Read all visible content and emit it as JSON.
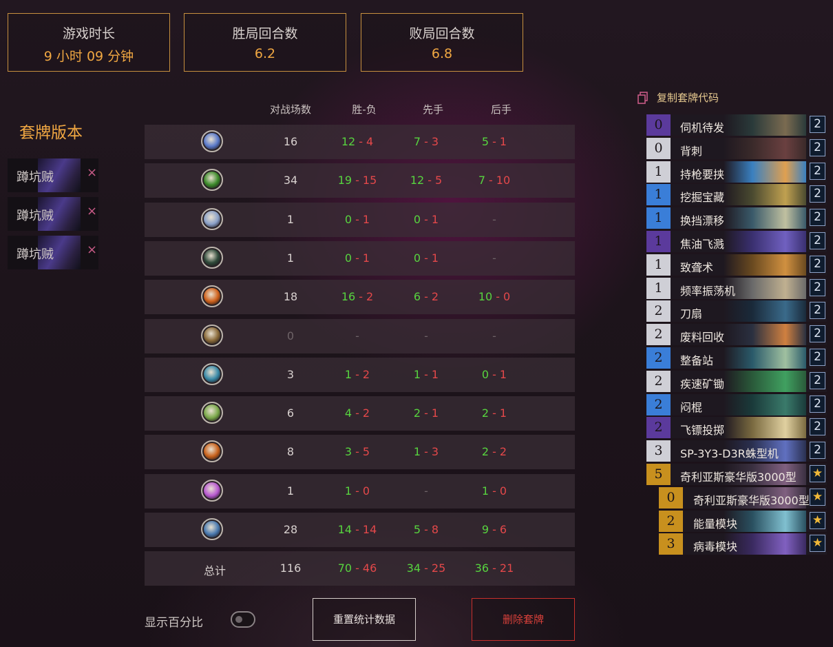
{
  "stats": {
    "playtime": {
      "label": "游戏时长",
      "value": "9 小时 09 分钟"
    },
    "win_turns": {
      "label": "胜局回合数",
      "value": "6.2"
    },
    "loss_turns": {
      "label": "败局回合数",
      "value": "6.8"
    }
  },
  "versions": {
    "title": "套牌版本",
    "items": [
      "蹲坑贼",
      "蹲坑贼",
      "蹲坑贼"
    ],
    "remove_symbol": "×"
  },
  "table": {
    "headers": {
      "games": "对战场数",
      "wl": "胜-负",
      "first": "先手",
      "second": "后手"
    },
    "dash": "-",
    "rows": [
      {
        "icon": "mage-class-icon",
        "color": "#5a79c9",
        "games": "16",
        "wl": [
          "12",
          "4"
        ],
        "first": [
          "7",
          "3"
        ],
        "second": [
          "5",
          "1"
        ]
      },
      {
        "icon": "warlock-class-icon",
        "color": "#3c8a2a",
        "games": "34",
        "wl": [
          "19",
          "15"
        ],
        "first": [
          "12",
          "5"
        ],
        "second": [
          "7",
          "10"
        ]
      },
      {
        "icon": "druid-class-icon",
        "color": "#8aa0c8",
        "games": "1",
        "wl": [
          "0",
          "1"
        ],
        "first": [
          "0",
          "1"
        ],
        "second": null
      },
      {
        "icon": "hunter-class-icon",
        "color": "#2f4a3a",
        "games": "1",
        "wl": [
          "0",
          "1"
        ],
        "first": [
          "0",
          "1"
        ],
        "second": null
      },
      {
        "icon": "shaman-class-icon",
        "color": "#d0621c",
        "games": "18",
        "wl": [
          "16",
          "2"
        ],
        "first": [
          "6",
          "2"
        ],
        "second": [
          "10",
          "0"
        ]
      },
      {
        "icon": "paladin-class-icon",
        "color": "#8a6a3a",
        "games": "0",
        "wl": null,
        "first": null,
        "second": null,
        "dim": true
      },
      {
        "icon": "rogue-class-icon",
        "color": "#3a8aa8",
        "games": "3",
        "wl": [
          "1",
          "2"
        ],
        "first": [
          "1",
          "1"
        ],
        "second": [
          "0",
          "1"
        ]
      },
      {
        "icon": "demon-hunter-class-icon",
        "color": "#7aa84a",
        "games": "6",
        "wl": [
          "4",
          "2"
        ],
        "first": [
          "2",
          "1"
        ],
        "second": [
          "2",
          "1"
        ]
      },
      {
        "icon": "warrior-class-icon",
        "color": "#c8621c",
        "games": "8",
        "wl": [
          "3",
          "5"
        ],
        "first": [
          "1",
          "3"
        ],
        "second": [
          "2",
          "2"
        ]
      },
      {
        "icon": "priest-class-icon",
        "color": "#b85ad0",
        "games": "1",
        "wl": [
          "1",
          "0"
        ],
        "first": null,
        "second": [
          "1",
          "0"
        ]
      },
      {
        "icon": "knight-class-icon",
        "color": "#4a7ab0",
        "games": "28",
        "wl": [
          "14",
          "14"
        ],
        "first": [
          "5",
          "8"
        ],
        "second": [
          "9",
          "6"
        ]
      }
    ],
    "total": {
      "label": "总计",
      "games": "116",
      "wl": [
        "70",
        "46"
      ],
      "first": [
        "34",
        "25"
      ],
      "second": [
        "36",
        "21"
      ]
    }
  },
  "deck": {
    "copy_label": "复制套牌代码",
    "cards": [
      {
        "cost": "0",
        "name": "伺机待发",
        "count": "2",
        "rarity": "#5b3a9c",
        "art": [
          "#2a3a3a",
          "#7a6a50"
        ]
      },
      {
        "cost": "0",
        "name": "背刺",
        "count": "2",
        "rarity": "#cfcfd6",
        "art": [
          "#3a2a2a",
          "#6a4040"
        ]
      },
      {
        "cost": "1",
        "name": "持枪要挟",
        "count": "2",
        "rarity": "#cfcfd6",
        "art": [
          "#3a80c0",
          "#e0a050"
        ]
      },
      {
        "cost": "1",
        "name": "挖掘宝藏",
        "count": "2",
        "rarity": "#3a7ed8",
        "art": [
          "#4a4a30",
          "#c0a050"
        ]
      },
      {
        "cost": "1",
        "name": "换挡漂移",
        "count": "2",
        "rarity": "#3a7ed8",
        "art": [
          "#3a5a6a",
          "#c0c0a0"
        ]
      },
      {
        "cost": "1",
        "name": "焦油飞溅",
        "count": "2",
        "rarity": "#5b3a9c",
        "art": [
          "#3a3070",
          "#7060c0"
        ]
      },
      {
        "cost": "1",
        "name": "致聋术",
        "count": "2",
        "rarity": "#cfcfd6",
        "art": [
          "#6a4a20",
          "#d09040"
        ]
      },
      {
        "cost": "1",
        "name": "频率振荡机",
        "count": "2",
        "rarity": "#cfcfd6",
        "art": [
          "#6a6a6a",
          "#c0b090"
        ]
      },
      {
        "cost": "2",
        "name": "刀扇",
        "count": "2",
        "rarity": "#cfcfd6",
        "art": [
          "#1a2a3a",
          "#3a6a8a"
        ]
      },
      {
        "cost": "2",
        "name": "废料回收",
        "count": "2",
        "rarity": "#cfcfd6",
        "art": [
          "#2a3040",
          "#d08040"
        ]
      },
      {
        "cost": "2",
        "name": "整备站",
        "count": "2",
        "rarity": "#3a7ed8",
        "art": [
          "#2a5a6a",
          "#a0c0a0"
        ]
      },
      {
        "cost": "2",
        "name": "疾速矿锄",
        "count": "2",
        "rarity": "#cfcfd6",
        "art": [
          "#2a5a3a",
          "#40a060"
        ]
      },
      {
        "cost": "2",
        "name": "闷棍",
        "count": "2",
        "rarity": "#3a7ed8",
        "art": [
          "#1a3a3a",
          "#3a7a6a"
        ]
      },
      {
        "cost": "2",
        "name": "飞镖投掷",
        "count": "2",
        "rarity": "#5b3a9c",
        "art": [
          "#7a6a40",
          "#e0d0a0"
        ]
      },
      {
        "cost": "3",
        "name": "SP-3Y3-D3R蛛型机",
        "count": "2",
        "rarity": "#cfcfd6",
        "art": [
          "#2a3050",
          "#6070c0"
        ]
      },
      {
        "cost": "5",
        "name": "奇利亚斯豪华版3000型",
        "count": "★",
        "rarity": "#c8901e",
        "art": [
          "#3a3040",
          "#806080"
        ]
      },
      {
        "cost": "0",
        "name": "奇利亚斯豪华版3000型",
        "count": "★",
        "rarity": "#c8901e",
        "art": [
          "#3a3040",
          "#806080"
        ],
        "sub": true
      },
      {
        "cost": "2",
        "name": "能量模块",
        "count": "★",
        "rarity": "#c8901e",
        "art": [
          "#2a5060",
          "#80c0d0"
        ],
        "sub": true
      },
      {
        "cost": "3",
        "name": "病毒模块",
        "count": "★",
        "rarity": "#c8901e",
        "art": [
          "#3a2a60",
          "#8060c0"
        ],
        "sub": true
      }
    ]
  },
  "controls": {
    "percent_label": "显示百分比",
    "reset_label": "重置统计数据",
    "delete_label": "删除套牌"
  },
  "colors": {
    "accent": "#f0a742",
    "win": "#57d43f",
    "loss": "#e4484a",
    "delete": "#c9302c"
  }
}
